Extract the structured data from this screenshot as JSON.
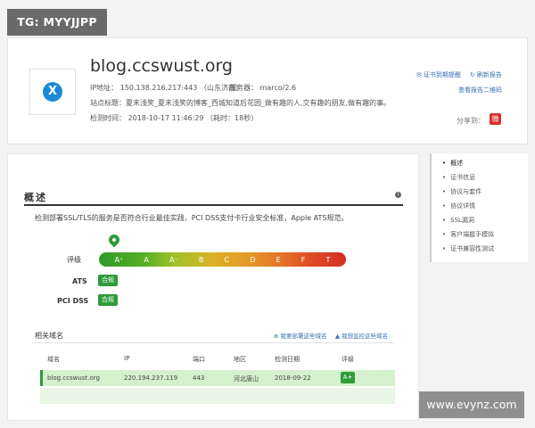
{
  "watermarks": {
    "top": "TG: MYYJJPP",
    "bottom": "www.evynz.com"
  },
  "header": {
    "logo_letter": "X",
    "title": "blog.ccswust.org",
    "ip_line": "IP地址：   150.138.216.217:443 （山东济南）",
    "server_line": "服务器：   marco/2.6",
    "site_title_line": "站点标题：夏末浅笑_夏末浅笑的博客_西城知道后花园_做有趣的人,交有趣的朋友,做有趣的事。",
    "check_time_line": "检测时间：  2018-10-17 11:46:29 （耗时：18秒）",
    "cert_reminder": "证书到期提醒",
    "refresh_report": "刷新报告",
    "view_qr": "查看报告二维码",
    "share_label": "分享到："
  },
  "overview": {
    "title": "概述",
    "description": "检测部署SSL/TLS的服务是否符合行业最佳实践，PCI DSS支付卡行业安全标准，Apple ATS规范。",
    "grade_label": "评级",
    "grades": [
      "A⁺",
      "A",
      "A⁻",
      "B",
      "C",
      "D",
      "E",
      "F",
      "T"
    ],
    "ats_label": "ATS",
    "ats_value": "合规",
    "pci_label": "PCI DSS",
    "pci_value": "合规"
  },
  "related_domains": {
    "title": "相关域名",
    "link_deploy": "我要部署这些域名",
    "link_monitor": "我想监控这些域名",
    "columns": [
      "域名",
      "IP",
      "端口",
      "地区",
      "检测日期",
      "评级"
    ],
    "rows": [
      {
        "domain": "blog.ccswust.org",
        "ip": "220.194.237.119",
        "port": "443",
        "region": "河北唐山",
        "date": "2018-09-22",
        "grade": "A+"
      }
    ]
  },
  "side_nav": {
    "items": [
      "概述",
      "证书信息",
      "协议与套件",
      "协议详情",
      "SSL漏洞",
      "客户端握手模拟",
      "证书兼容性测试"
    ]
  },
  "colors": {
    "accent": "#2f9b3a",
    "link": "#3a6fb2",
    "weibo": "#d8302c"
  }
}
